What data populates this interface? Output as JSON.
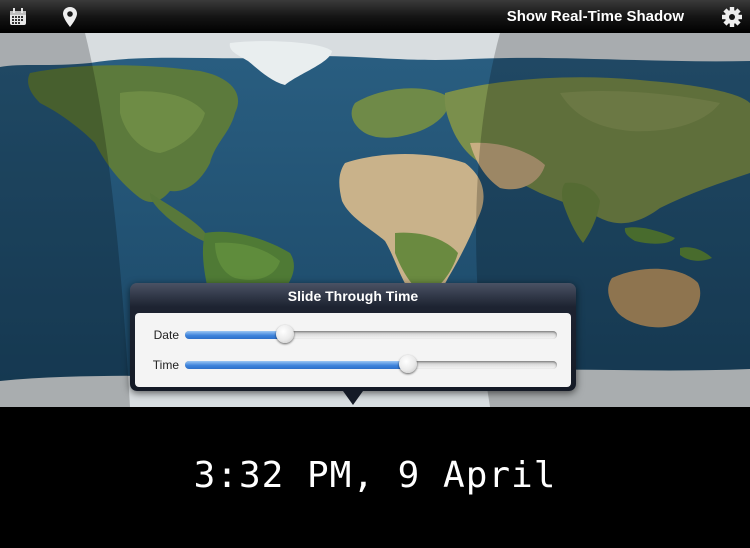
{
  "toolbar": {
    "calendar_icon": "calendar-icon",
    "location_icon": "map-pin-icon",
    "shadow_label": "Show Real-Time Shadow",
    "settings_icon": "gear-icon"
  },
  "popover": {
    "title": "Slide Through Time",
    "sliders": [
      {
        "label": "Date",
        "value": 0.27
      },
      {
        "label": "Time",
        "value": 0.6
      }
    ]
  },
  "time_display": "3:32 PM, 9 April",
  "colors": {
    "ocean": "#1f4d6e",
    "slider_fill": "#3f84dc",
    "toolbar": "#151515"
  }
}
